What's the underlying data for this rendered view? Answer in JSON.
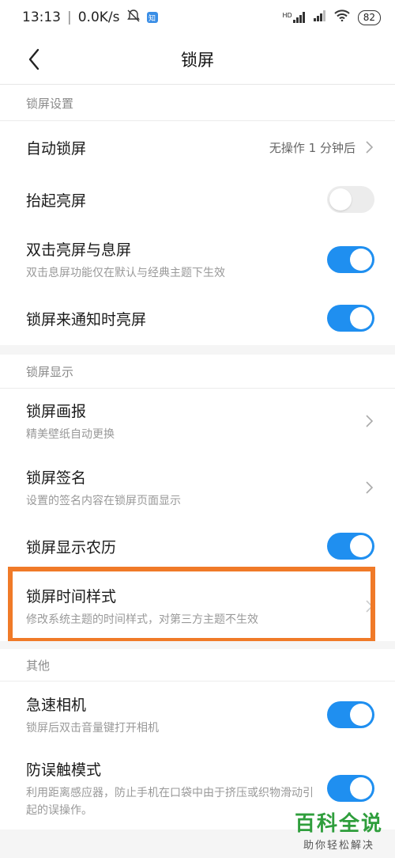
{
  "status": {
    "time": "13:13",
    "speed": "0.0K/s",
    "app_badge": "知",
    "network": "HD",
    "battery": "82"
  },
  "header": {
    "title": "锁屏"
  },
  "sections": {
    "lock_settings": "锁屏设置",
    "lock_display": "锁屏显示",
    "other": "其他"
  },
  "items": {
    "auto_lock": {
      "title": "自动锁屏",
      "value": "无操作 1 分钟后"
    },
    "raise_wake": {
      "title": "抬起亮屏",
      "enabled": false
    },
    "double_tap": {
      "title": "双击亮屏与息屏",
      "subtitle": "双击息屏功能仅在默认与经典主题下生效",
      "enabled": true
    },
    "notify_wake": {
      "title": "锁屏来通知时亮屏",
      "enabled": true
    },
    "wallpaper": {
      "title": "锁屏画报",
      "subtitle": "精美壁纸自动更换"
    },
    "signature": {
      "title": "锁屏签名",
      "subtitle": "设置的签名内容在锁屏页面显示"
    },
    "lunar": {
      "title": "锁屏显示农历",
      "enabled": true
    },
    "clock_style": {
      "title": "锁屏时间样式",
      "subtitle": "修改系统主题的时间样式，对第三方主题不生效"
    },
    "quick_camera": {
      "title": "急速相机",
      "subtitle": "锁屏后双击音量键打开相机",
      "enabled": true
    },
    "anti_touch": {
      "title": "防误触模式",
      "subtitle": "利用距离感应器，防止手机在口袋中由于挤压或织物滑动引起的误操作。",
      "enabled": true
    }
  },
  "watermark": {
    "main": "百科全说",
    "sub": "助你轻松解决"
  },
  "colors": {
    "accent": "#1f8ff0",
    "highlight": "#f07a28",
    "watermark": "#2f9e3c"
  }
}
